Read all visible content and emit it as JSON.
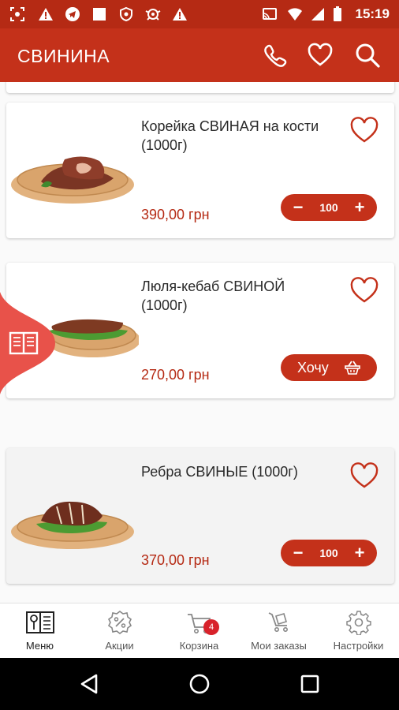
{
  "status_bar": {
    "time": "15:19",
    "icons": [
      "screenshot-icon",
      "warning-icon",
      "telegram-icon",
      "square-icon",
      "shield-icon",
      "bug-icon",
      "warning-icon",
      "cast-icon",
      "wifi-icon",
      "signal-icon",
      "battery-icon"
    ]
  },
  "app_bar": {
    "title": "СВИНИНА",
    "actions": [
      "phone-icon",
      "heart-icon",
      "search-icon"
    ]
  },
  "products": [
    {
      "name": "Корейка СВИНАЯ на кости  (1000г)",
      "price": "390,00 грн",
      "quantity": "100",
      "action": "stepper"
    },
    {
      "name": "Люля-кебаб СВИНОЙ (1000г)",
      "price": "270,00 грн",
      "button_label": "Хочу",
      "action": "want"
    },
    {
      "name": "Ребра СВИНЫЕ (1000г)",
      "price": "370,00 грн",
      "quantity": "100",
      "action": "stepper"
    }
  ],
  "bottom_nav": [
    {
      "label": "Меню",
      "icon": "menu-book-icon",
      "active": true
    },
    {
      "label": "Акции",
      "icon": "discount-icon"
    },
    {
      "label": "Корзина",
      "icon": "cart-icon",
      "badge": "4"
    },
    {
      "label": "Мои заказы",
      "icon": "orders-cart-icon"
    },
    {
      "label": "Настройки",
      "icon": "settings-gear-icon"
    }
  ],
  "colors": {
    "accent": "#c4311a",
    "status_bar": "#b52a14",
    "price": "#b52a14",
    "heart": "#c4311a",
    "badge": "#d8222b"
  },
  "system_nav": [
    "back-icon",
    "home-icon",
    "recents-icon"
  ]
}
